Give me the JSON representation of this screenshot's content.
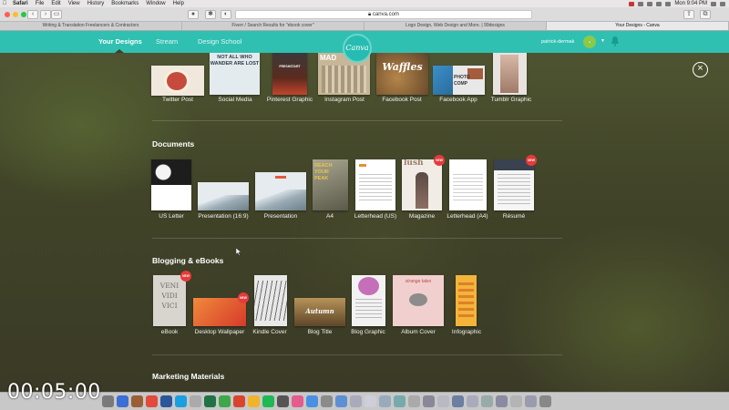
{
  "menubar": {
    "apple": "",
    "items": [
      "Safari",
      "File",
      "Edit",
      "View",
      "History",
      "Bookmarks",
      "Window",
      "Help"
    ],
    "clock": "Mon 9:04 PM"
  },
  "browser": {
    "url": "canva.com",
    "tabs": [
      {
        "label": "Writing & Translation Freelancers & Contractors",
        "active": false
      },
      {
        "label": "Fiverr / Search Results for \"ebook cover\"",
        "active": false
      },
      {
        "label": "Logo Design, Web Design and More. | 99designs",
        "active": false
      },
      {
        "label": "Your Designs - Canva",
        "active": true
      }
    ]
  },
  "header": {
    "nav": [
      "Your Designs",
      "Stream",
      "Design School"
    ],
    "logo": "Canva",
    "username": "patrick-dermak",
    "colors": {
      "header": "#2fc0b2",
      "new_badge": "#e73a3a"
    }
  },
  "social": {
    "items": [
      "Twitter Post",
      "Social Media",
      "Pinterest Graphic",
      "Instagram Post",
      "Facebook Post",
      "Facebook App",
      "Tumblr Graphic"
    ],
    "thumb_text": {
      "social_media": "NOT ALL WHO WANDER ARE LOST",
      "pinterest": "FRESHSTART",
      "instagram": "MAD",
      "facebook": "Waffles",
      "facebook_app": "PHOTO COMP"
    }
  },
  "documents": {
    "title": "Documents",
    "items": [
      "US Letter",
      "Presentation (16:9)",
      "Presentation",
      "A4",
      "Letterhead (US)",
      "Magazine",
      "Letterhead (A4)",
      "Résumé"
    ],
    "thumb_text": {
      "a4": "REACH YOUR PEAK",
      "magazine": "lush"
    }
  },
  "blogging": {
    "title": "Blogging & eBooks",
    "items": [
      "eBook",
      "Desktop Wallpaper",
      "Kindle Cover",
      "Blog Title",
      "Blog Graphic",
      "Album Cover",
      "Infographic"
    ],
    "thumb_text": {
      "ebook": "VENI VIDI VICI",
      "blog_title": "Autumn",
      "album": "strange tales"
    }
  },
  "marketing": {
    "title": "Marketing Materials"
  },
  "badges": {
    "new": "NEW"
  },
  "video": {
    "timer": "00:05:00"
  }
}
